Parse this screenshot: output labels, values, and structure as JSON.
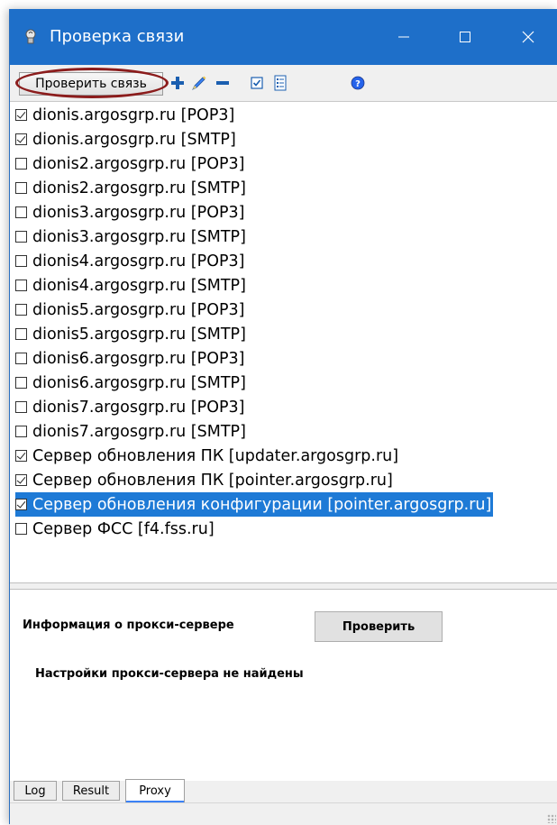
{
  "window": {
    "title": "Проверка связи",
    "controls": {
      "minimize": "—",
      "maximize": "☐",
      "close": "✕"
    },
    "accent_color": "#1e6fc9"
  },
  "toolbar": {
    "check_connection_label": "Проверить связь",
    "icons": [
      "add-icon",
      "edit-icon",
      "remove-icon",
      "check-all-icon",
      "list-icon",
      "help-icon"
    ]
  },
  "servers": [
    {
      "label": "dionis.argosgrp.ru [POP3]",
      "checked": true
    },
    {
      "label": "dionis.argosgrp.ru [SMTP]",
      "checked": true
    },
    {
      "label": "dionis2.argosgrp.ru [POP3]",
      "checked": false
    },
    {
      "label": "dionis2.argosgrp.ru [SMTP]",
      "checked": false
    },
    {
      "label": "dionis3.argosgrp.ru [POP3]",
      "checked": false
    },
    {
      "label": "dionis3.argosgrp.ru [SMTP]",
      "checked": false
    },
    {
      "label": "dionis4.argosgrp.ru [POP3]",
      "checked": false
    },
    {
      "label": "dionis4.argosgrp.ru [SMTP]",
      "checked": false
    },
    {
      "label": "dionis5.argosgrp.ru [POP3]",
      "checked": false
    },
    {
      "label": "dionis5.argosgrp.ru [SMTP]",
      "checked": false
    },
    {
      "label": "dionis6.argosgrp.ru [POP3]",
      "checked": false
    },
    {
      "label": "dionis6.argosgrp.ru [SMTP]",
      "checked": false
    },
    {
      "label": "dionis7.argosgrp.ru [POP3]",
      "checked": false
    },
    {
      "label": "dionis7.argosgrp.ru [SMTP]",
      "checked": false
    },
    {
      "label": "Сервер обновления ПК [updater.argosgrp.ru]",
      "checked": true
    },
    {
      "label": "Сервер обновления ПК [pointer.argosgrp.ru]",
      "checked": true
    },
    {
      "label": "Сервер обновления конфигурации [pointer.argosgrp.ru]",
      "checked": true,
      "selected": true
    },
    {
      "label": "Сервер ФСС [f4.fss.ru]",
      "checked": false
    }
  ],
  "proxy": {
    "info_label": "Информация о прокси-сервере",
    "check_button": "Проверить",
    "status": "Настройки прокси-сервера не найдены"
  },
  "tabs": [
    {
      "label": "Log",
      "active": false
    },
    {
      "label": "Result",
      "active": false
    },
    {
      "label": "Proxy",
      "active": true
    }
  ]
}
